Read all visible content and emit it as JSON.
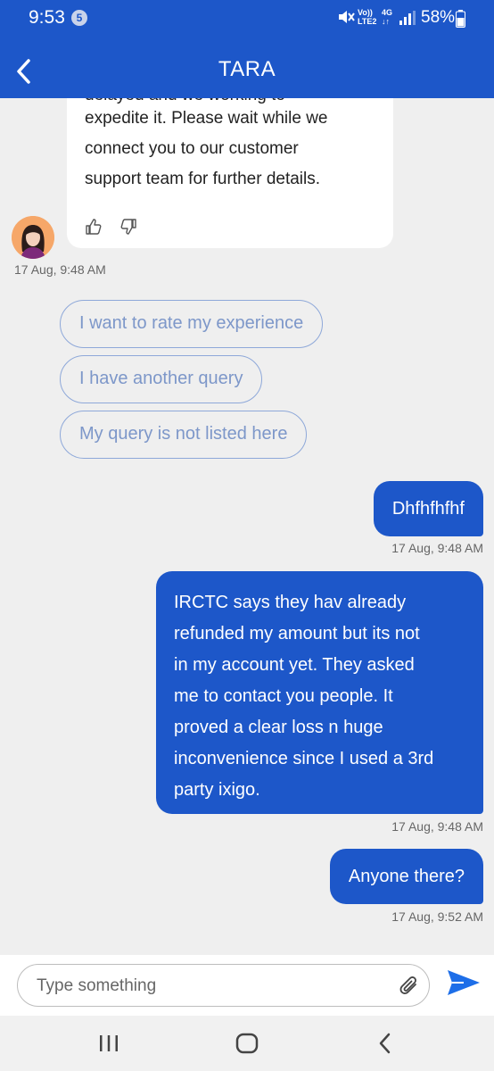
{
  "status_bar": {
    "time": "9:53",
    "notification_count": "5",
    "volte_line1": "Vo))",
    "volte_line2": "LTE2",
    "network_type": "4G",
    "network_arrows": "↓↑",
    "battery": "58%"
  },
  "header": {
    "title": "TARA",
    "back_icon": "chevron-left-icon"
  },
  "chat": {
    "bot_message": {
      "cut_line": "delayed and we working to",
      "lines": [
        "expedite it. Please wait while we",
        "connect you to our customer",
        "support team for further details."
      ],
      "time": "17 Aug, 9:48 AM",
      "feedback_icons": [
        "thumbs-up-icon",
        "thumbs-down-icon"
      ]
    },
    "quick_replies": [
      "I want to rate my experience",
      "I have another query",
      "My query is not listed here"
    ],
    "user_messages": [
      {
        "text": "Dhfhfhfhf",
        "time": "17 Aug, 9:48 AM"
      },
      {
        "lines": [
          "IRCTC says they hav already",
          "refunded my amount but its not",
          "in my account yet. They asked",
          "me to contact you people. It",
          "proved a clear loss n huge",
          "inconvenience since I used a 3rd",
          "party ixigo."
        ],
        "time": "17 Aug, 9:48 AM"
      },
      {
        "text": "Anyone there?",
        "time": "17 Aug, 9:52 AM"
      }
    ]
  },
  "composer": {
    "placeholder": "Type something",
    "attach_icon": "paperclip-icon",
    "send_icon": "send-icon"
  },
  "colors": {
    "brand": "#1d57c9",
    "background": "#efefef",
    "quick_reply_border": "#8ea8d9"
  }
}
